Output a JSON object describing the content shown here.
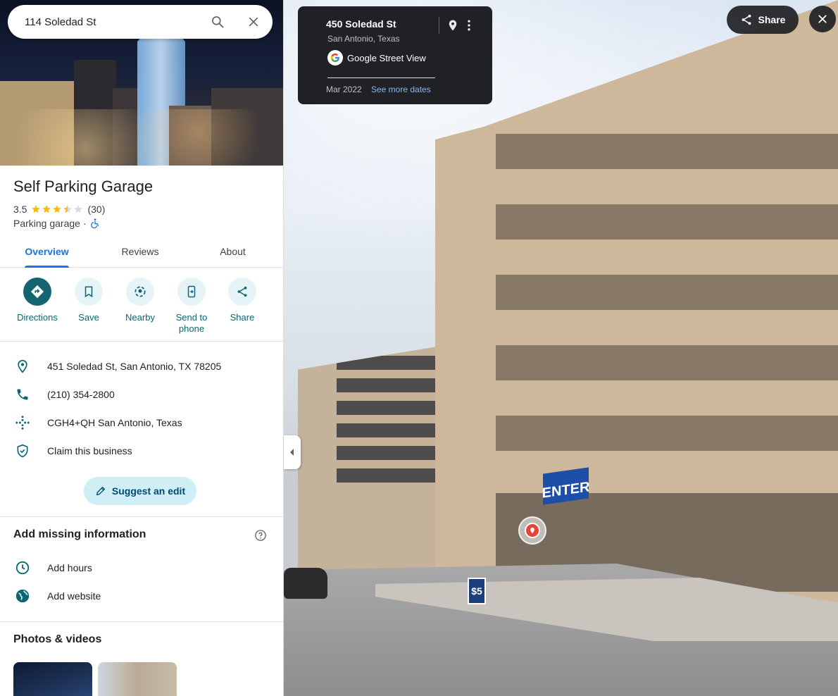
{
  "search": {
    "value": "114 Soledad St"
  },
  "place": {
    "title": "Self Parking Garage",
    "rating": "3.5",
    "rating_stars": 3.5,
    "review_count": "(30)",
    "category": "Parking garage",
    "separator": "·"
  },
  "tabs": [
    {
      "label": "Overview",
      "active": true
    },
    {
      "label": "Reviews",
      "active": false
    },
    {
      "label": "About",
      "active": false
    }
  ],
  "actions": [
    {
      "label": "Directions",
      "icon": "directions-icon"
    },
    {
      "label": "Save",
      "icon": "bookmark-icon"
    },
    {
      "label": "Nearby",
      "icon": "nearby-icon"
    },
    {
      "label_line1": "Send to",
      "label_line2": "phone",
      "icon": "send-to-phone-icon"
    },
    {
      "label": "Share",
      "icon": "share-icon"
    }
  ],
  "info": {
    "address": "451 Soledad St, San Antonio, TX 78205",
    "phone": "(210) 354-2800",
    "plus_code": "CGH4+QH San Antonio, Texas",
    "claim": "Claim this business"
  },
  "suggest_edit": "Suggest an edit",
  "missing": {
    "title": "Add missing information",
    "items": [
      "Add hours",
      "Add website"
    ]
  },
  "photos": {
    "title": "Photos & videos"
  },
  "streetview": {
    "address": "450 Soledad St",
    "city": "San Antonio, Texas",
    "provider": "Google Street View",
    "date": "Mar 2022",
    "more_dates": "See more dates",
    "share_label": "Share",
    "sign_enter": "ENTER",
    "sign_price": "$5"
  },
  "colors": {
    "accent": "#1a73e8",
    "action_primary": "#14656f",
    "action_bg": "#e6f4f7",
    "star": "#fbbc04",
    "card_bg": "#202124",
    "link_light": "#8ab4f8"
  }
}
